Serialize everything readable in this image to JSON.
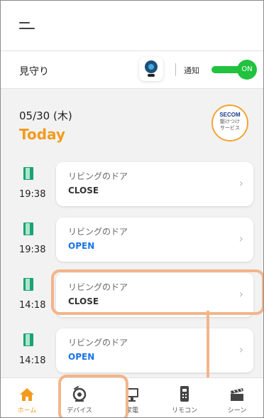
{
  "header": {
    "menu_icon": "hamburger-icon"
  },
  "watch": {
    "title": "見守り",
    "camera_icon": "camera-icon",
    "notification_label": "通知",
    "toggle_state": "ON",
    "toggle_color": "#20c23e"
  },
  "date": {
    "date_text": "05/30 (木)",
    "today_label": "Today",
    "accent_color": "#f39a1e"
  },
  "secom": {
    "logo": "SECOM",
    "sub": "駆けつけ\nサービス"
  },
  "events": [
    {
      "time": "19:38",
      "name": "リビングのドア",
      "status": "CLOSE",
      "status_color": "#333333",
      "icon": "door-icon"
    },
    {
      "time": "19:38",
      "name": "リビングのドア",
      "status": "OPEN",
      "status_color": "#1a73e8",
      "icon": "door-icon"
    },
    {
      "time": "14:18",
      "name": "リビングのドア",
      "status": "CLOSE",
      "status_color": "#333333",
      "icon": "door-icon"
    },
    {
      "time": "14:18",
      "name": "リビングのドア",
      "status": "OPEN",
      "status_color": "#1a73e8",
      "icon": "door-icon"
    }
  ],
  "chevron": "›",
  "nav": [
    {
      "label": "ホーム",
      "icon": "home-icon",
      "active": true
    },
    {
      "label": "デバイス",
      "icon": "camera-device-icon",
      "active": false
    },
    {
      "label": "家電",
      "icon": "monitor-icon",
      "active": false
    },
    {
      "label": "リモコン",
      "icon": "remote-icon",
      "active": false
    },
    {
      "label": "シーン",
      "icon": "clapperboard-icon",
      "active": false
    }
  ],
  "highlight_color": "#f3b58a"
}
